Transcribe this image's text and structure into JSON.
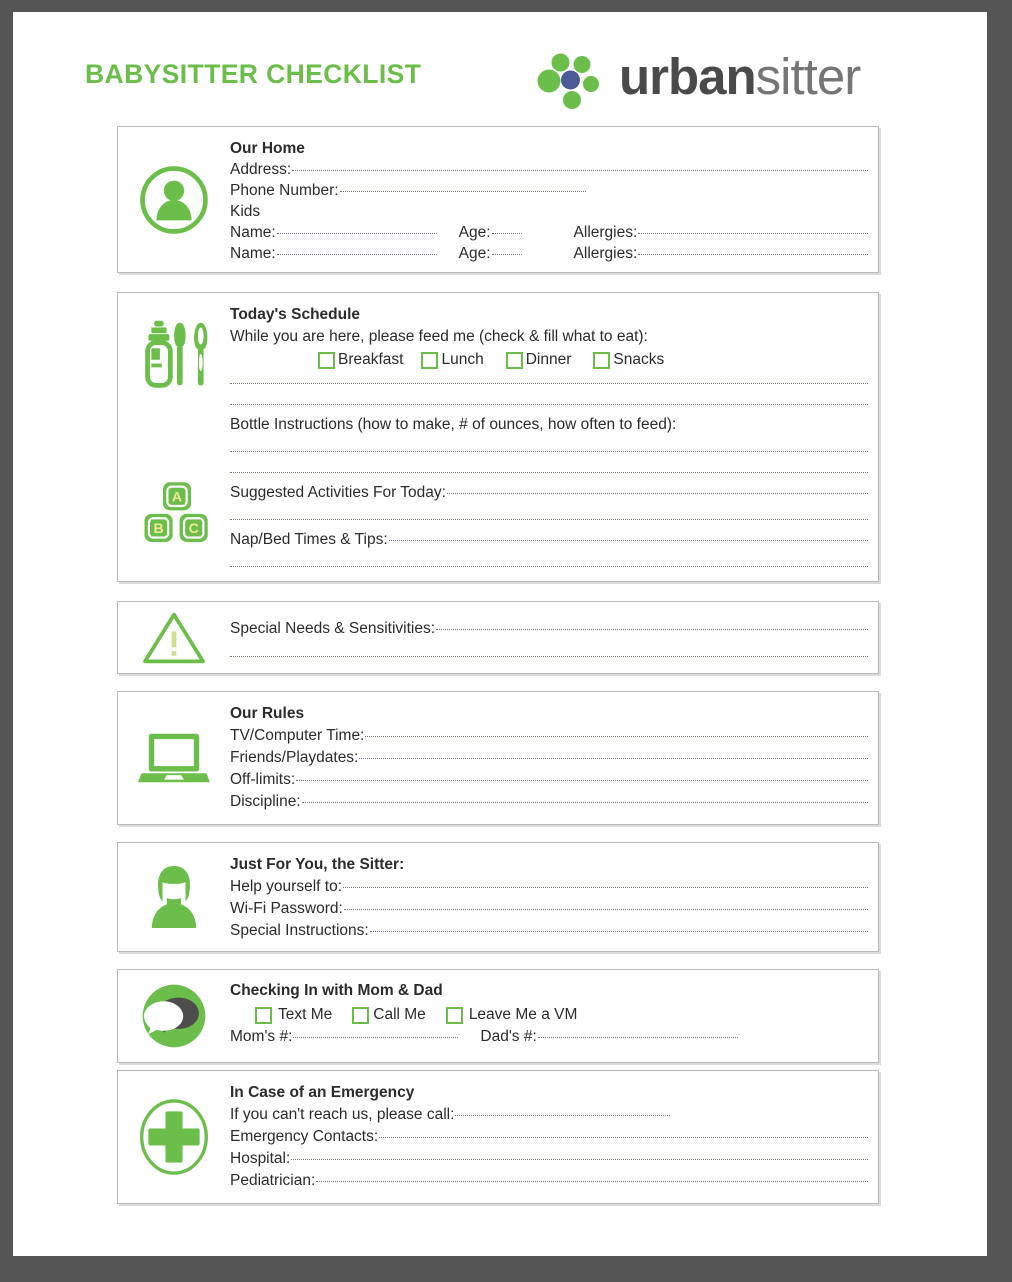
{
  "header": {
    "title": "BABYSITTER CHECKLIST",
    "logo_word_bold": "urban",
    "logo_word_light": "sitter"
  },
  "colors": {
    "green": "#6cbe4a",
    "logo_blue": "#4c5a96",
    "text": "#2b2b2b",
    "rule": "#6e6e8a",
    "frame": "#555555",
    "box_border": "#b9b9b9"
  },
  "sections": [
    {
      "id": "our-home",
      "icon": "person-in-circle-icon",
      "title": "Our Home",
      "rows": [
        {
          "label": "Address:"
        },
        {
          "label": "Phone Number:"
        },
        {
          "label": "Kids"
        },
        {
          "label": "Name:",
          "label2": "Age:",
          "label3": "Allergies:"
        },
        {
          "label": "Name:",
          "label2": "Age:",
          "label3": "Allergies:"
        }
      ]
    },
    {
      "id": "todays-schedule",
      "icon": "baby-bottle-utensils-icon",
      "icon2": "abc-blocks-icon",
      "title": "Today's Schedule",
      "feed_prompt": "While you are here, please feed me (check & fill what to eat):",
      "checkboxes": [
        "Breakfast",
        "Lunch",
        "Dinner",
        "Snacks"
      ],
      "bottle_label": "Bottle Instructions (how to make, # of ounces, how often to feed):",
      "activities_label": "Suggested Activities For Today:",
      "nap_label": "Nap/Bed Times & Tips:"
    },
    {
      "id": "special-needs",
      "icon": "warning-triangle-icon",
      "label": "Special Needs & Sensitivities:"
    },
    {
      "id": "our-rules",
      "icon": "laptop-icon",
      "title": "Our Rules",
      "rows": [
        {
          "label": "TV/Computer Time:"
        },
        {
          "label": "Friends/Playdates:"
        },
        {
          "label": "Off-limits:"
        },
        {
          "label": "Discipline:"
        }
      ]
    },
    {
      "id": "just-for-you",
      "icon": "sitter-person-icon",
      "title": "Just For You, the Sitter:",
      "rows": [
        {
          "label": "Help yourself to:"
        },
        {
          "label": "Wi-Fi Password:"
        },
        {
          "label": "Special Instructions:"
        }
      ]
    },
    {
      "id": "checking-in",
      "icon": "chat-bubbles-icon",
      "title": "Checking In with Mom & Dad",
      "checkboxes": [
        "Text Me",
        "Call Me",
        "Leave Me a VM"
      ],
      "moms_label": "Mom's #:",
      "dads_label": "Dad's #:"
    },
    {
      "id": "emergency",
      "icon": "medical-cross-icon",
      "title": "In Case of an Emergency",
      "rows": [
        {
          "label": "If you can't reach us, please call:"
        },
        {
          "label": "Emergency Contacts:"
        },
        {
          "label": "Hospital:"
        },
        {
          "label": "Pediatrician:"
        }
      ]
    }
  ]
}
